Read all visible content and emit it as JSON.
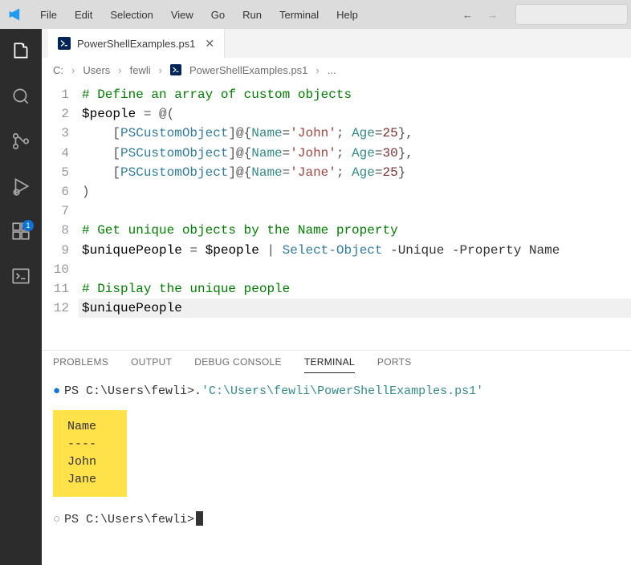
{
  "menu": {
    "items": [
      "File",
      "Edit",
      "Selection",
      "View",
      "Go",
      "Run",
      "Terminal",
      "Help"
    ]
  },
  "tab": {
    "label": "PowerShellExamples.ps1"
  },
  "breadcrumb": {
    "parts": [
      "C:",
      "Users",
      "fewli"
    ],
    "file": "PowerShellExamples.ps1",
    "trailing": "..."
  },
  "activitybar": {
    "badge": "1"
  },
  "editor": {
    "lines": [
      {
        "n": 1,
        "segs": [
          {
            "c": "c-comment",
            "t": "# Define an array of custom objects"
          }
        ]
      },
      {
        "n": 2,
        "segs": [
          {
            "c": "c-var",
            "t": "$people"
          },
          {
            "c": "c-punct",
            "t": " = "
          },
          {
            "c": "c-punct",
            "t": "@("
          }
        ]
      },
      {
        "n": 3,
        "segs": [
          {
            "c": "c-punct",
            "t": "    ["
          },
          {
            "c": "c-type",
            "t": "PSCustomObject"
          },
          {
            "c": "c-punct",
            "t": "]@{"
          },
          {
            "c": "c-name",
            "t": "Name"
          },
          {
            "c": "c-punct",
            "t": "="
          },
          {
            "c": "c-string",
            "t": "'John'"
          },
          {
            "c": "c-punct",
            "t": "; "
          },
          {
            "c": "c-name",
            "t": "Age"
          },
          {
            "c": "c-punct",
            "t": "="
          },
          {
            "c": "c-num",
            "t": "25"
          },
          {
            "c": "c-punct",
            "t": "},"
          }
        ]
      },
      {
        "n": 4,
        "segs": [
          {
            "c": "c-punct",
            "t": "    ["
          },
          {
            "c": "c-type",
            "t": "PSCustomObject"
          },
          {
            "c": "c-punct",
            "t": "]@{"
          },
          {
            "c": "c-name",
            "t": "Name"
          },
          {
            "c": "c-punct",
            "t": "="
          },
          {
            "c": "c-string",
            "t": "'John'"
          },
          {
            "c": "c-punct",
            "t": "; "
          },
          {
            "c": "c-name",
            "t": "Age"
          },
          {
            "c": "c-punct",
            "t": "="
          },
          {
            "c": "c-num",
            "t": "30"
          },
          {
            "c": "c-punct",
            "t": "},"
          }
        ]
      },
      {
        "n": 5,
        "segs": [
          {
            "c": "c-punct",
            "t": "    ["
          },
          {
            "c": "c-type",
            "t": "PSCustomObject"
          },
          {
            "c": "c-punct",
            "t": "]@{"
          },
          {
            "c": "c-name",
            "t": "Name"
          },
          {
            "c": "c-punct",
            "t": "="
          },
          {
            "c": "c-string",
            "t": "'Jane'"
          },
          {
            "c": "c-punct",
            "t": "; "
          },
          {
            "c": "c-name",
            "t": "Age"
          },
          {
            "c": "c-punct",
            "t": "="
          },
          {
            "c": "c-num",
            "t": "25"
          },
          {
            "c": "c-punct",
            "t": "}"
          }
        ]
      },
      {
        "n": 6,
        "segs": [
          {
            "c": "c-punct",
            "t": ")"
          }
        ]
      },
      {
        "n": 7,
        "segs": [
          {
            "c": "",
            "t": ""
          }
        ]
      },
      {
        "n": 8,
        "segs": [
          {
            "c": "c-comment",
            "t": "# Get unique objects by the Name property"
          }
        ]
      },
      {
        "n": 9,
        "segs": [
          {
            "c": "c-var",
            "t": "$uniquePeople"
          },
          {
            "c": "c-punct",
            "t": " = "
          },
          {
            "c": "c-var",
            "t": "$people"
          },
          {
            "c": "c-punct",
            "t": " | "
          },
          {
            "c": "c-cmd",
            "t": "Select-Object"
          },
          {
            "c": "c-flag",
            "t": " -Unique -Property Name"
          }
        ]
      },
      {
        "n": 10,
        "segs": [
          {
            "c": "",
            "t": ""
          }
        ]
      },
      {
        "n": 11,
        "segs": [
          {
            "c": "c-comment",
            "t": "# Display the unique people"
          }
        ]
      },
      {
        "n": 12,
        "segs": [
          {
            "c": "c-var",
            "t": "$uniquePeople"
          }
        ],
        "current": true
      }
    ]
  },
  "panel": {
    "tabs": [
      "PROBLEMS",
      "OUTPUT",
      "DEBUG CONSOLE",
      "TERMINAL",
      "PORTS"
    ],
    "activeTab": "TERMINAL",
    "terminal": {
      "prompt1": "PS C:\\Users\\fewli> ",
      "cmdPrefix": ". ",
      "cmdPath": "'C:\\Users\\fewli\\PowerShellExamples.ps1'",
      "output": [
        "Name",
        "----",
        "John",
        "Jane"
      ],
      "prompt2": "PS C:\\Users\\fewli> "
    }
  }
}
